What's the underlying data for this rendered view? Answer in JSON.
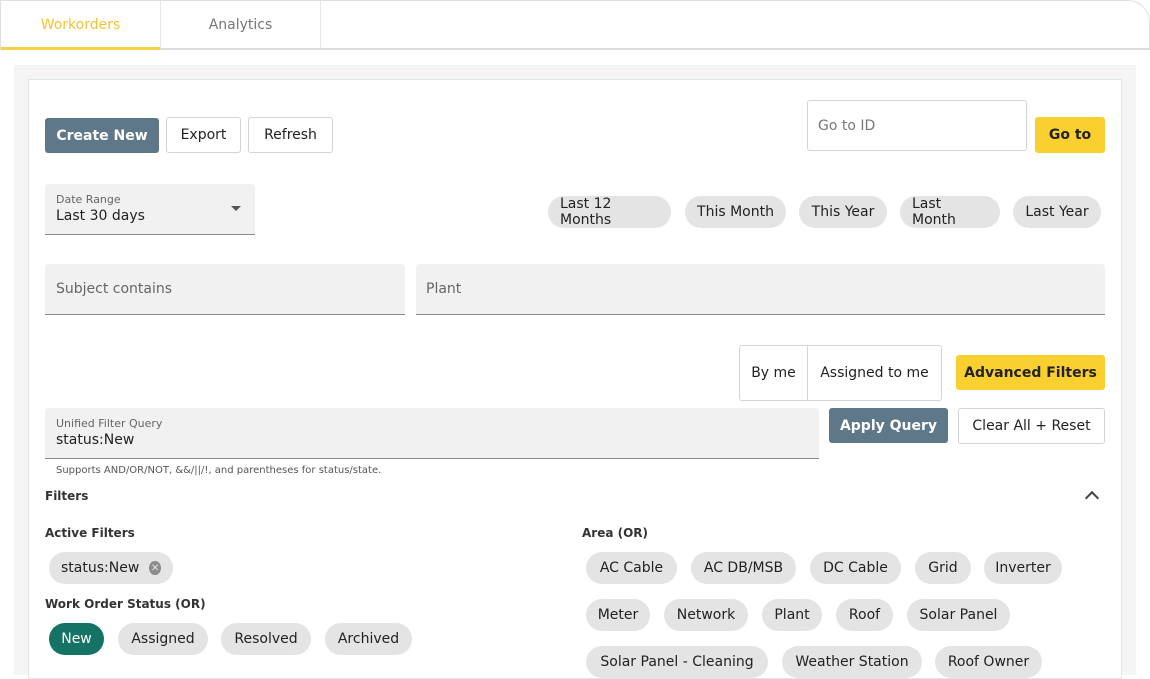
{
  "tabs": [
    {
      "label": "Workorders",
      "active": true
    },
    {
      "label": "Analytics",
      "active": false
    }
  ],
  "toolbar": {
    "create_new": "Create New",
    "export": "Export",
    "refresh": "Refresh",
    "goto_placeholder": "Go to ID",
    "goto_button": "Go to"
  },
  "date_range": {
    "label": "Date Range",
    "value": "Last 30 days",
    "quick": [
      "Last 12 Months",
      "This Month",
      "This Year",
      "Last Month",
      "Last Year"
    ]
  },
  "fields": {
    "subject_placeholder": "Subject contains",
    "plant_placeholder": "Plant"
  },
  "ownership": {
    "by_me": "By me",
    "assigned_to_me": "Assigned to me",
    "advanced_filters": "Advanced Filters"
  },
  "query": {
    "label": "Unified Filter Query",
    "value": "status:New",
    "apply": "Apply Query",
    "clear": "Clear All + Reset",
    "helper": "Supports AND/OR/NOT, &&/||/!, and parentheses for status/state."
  },
  "filters": {
    "title": "Filters",
    "active_label": "Active Filters",
    "active": [
      "status:New"
    ],
    "status_label": "Work Order Status (OR)",
    "status": [
      {
        "label": "New",
        "selected": true
      },
      {
        "label": "Assigned",
        "selected": false
      },
      {
        "label": "Resolved",
        "selected": false
      },
      {
        "label": "Archived",
        "selected": false
      }
    ],
    "area_label": "Area (OR)",
    "area": [
      "AC Cable",
      "AC DB/MSB",
      "DC Cable",
      "Grid",
      "Inverter",
      "Meter",
      "Network",
      "Plant",
      "Roof",
      "Solar Panel",
      "Solar Panel - Cleaning",
      "Weather Station",
      "Roof Owner"
    ]
  },
  "colors": {
    "accent_yellow": "#f9d030",
    "primary_slate": "#5f7889",
    "selected_green": "#147365"
  }
}
